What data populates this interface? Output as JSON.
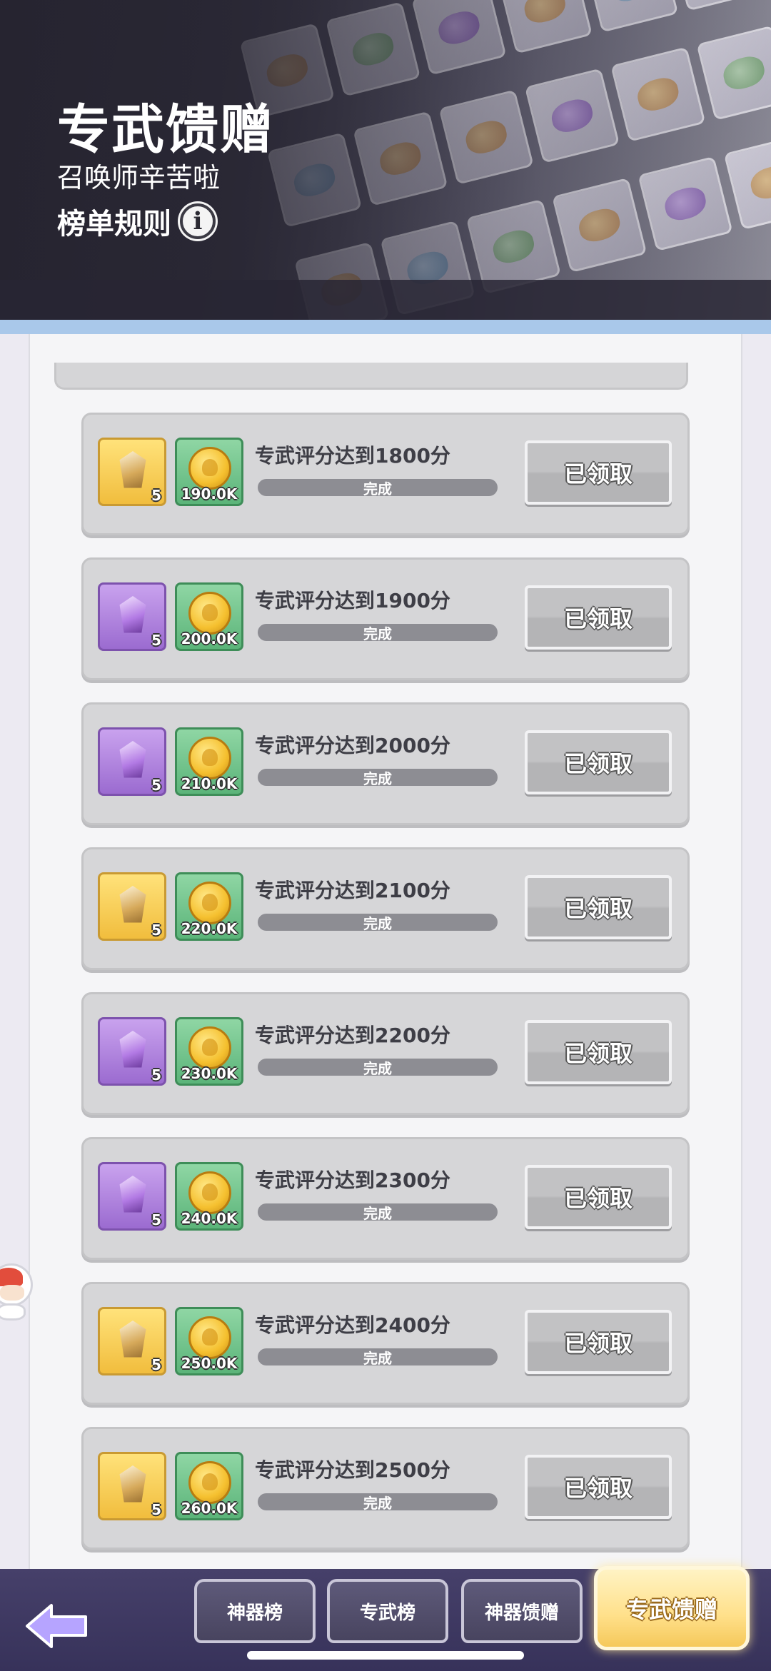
{
  "header": {
    "title": "专武馈赠",
    "subtitle": "召唤师辛苦啦",
    "rules_label": "榜单规则",
    "rules_icon": "info-icon"
  },
  "tasks": [
    {
      "reward1_type": "gold",
      "reward1_qty": "5",
      "reward2_amount": "190.0K",
      "task": "专武评分达到1800分",
      "progress": "完成",
      "button": "已领取"
    },
    {
      "reward1_type": "purple",
      "reward1_qty": "5",
      "reward2_amount": "200.0K",
      "task": "专武评分达到1900分",
      "progress": "完成",
      "button": "已领取"
    },
    {
      "reward1_type": "purple",
      "reward1_qty": "5",
      "reward2_amount": "210.0K",
      "task": "专武评分达到2000分",
      "progress": "完成",
      "button": "已领取"
    },
    {
      "reward1_type": "gold",
      "reward1_qty": "5",
      "reward2_amount": "220.0K",
      "task": "专武评分达到2100分",
      "progress": "完成",
      "button": "已领取"
    },
    {
      "reward1_type": "purple",
      "reward1_qty": "5",
      "reward2_amount": "230.0K",
      "task": "专武评分达到2200分",
      "progress": "完成",
      "button": "已领取"
    },
    {
      "reward1_type": "purple",
      "reward1_qty": "5",
      "reward2_amount": "240.0K",
      "task": "专武评分达到2300分",
      "progress": "完成",
      "button": "已领取"
    },
    {
      "reward1_type": "gold",
      "reward1_qty": "5",
      "reward2_amount": "250.0K",
      "task": "专武评分达到2400分",
      "progress": "完成",
      "button": "已领取"
    },
    {
      "reward1_type": "gold",
      "reward1_qty": "5",
      "reward2_amount": "260.0K",
      "task": "专武评分达到2500分",
      "progress": "完成",
      "button": "已领取"
    }
  ],
  "bottom_nav": {
    "back_icon": "arrow-left-icon",
    "tabs": [
      {
        "label": "神器榜",
        "active": false
      },
      {
        "label": "专武榜",
        "active": false
      },
      {
        "label": "神器馈赠",
        "active": false
      },
      {
        "label": "专武馈赠",
        "active": true
      }
    ]
  },
  "colors": {
    "header_dark": "#2b2936",
    "card_bg": "#d6d6d8",
    "gold_reward": "#f1bd3d",
    "purple_reward": "#9b6bd0",
    "green_reward": "#5bb479",
    "nav_bg": "#3f3a62",
    "active_tab": "#ffe08a"
  }
}
